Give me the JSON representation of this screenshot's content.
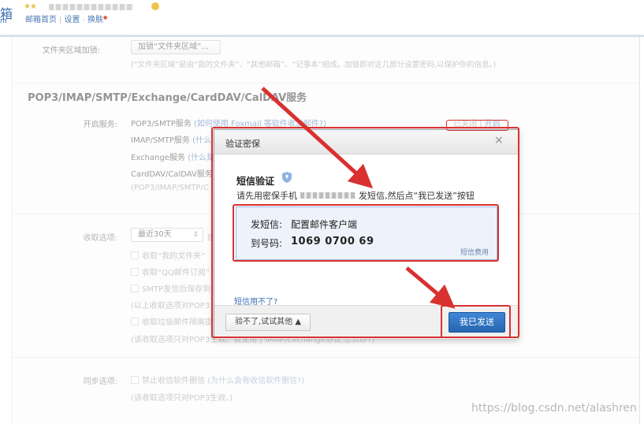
{
  "header": {
    "logo_char": "箱",
    "logo_sub": "m",
    "stars": "★★",
    "nav_home": "邮箱首页",
    "nav_settings": "设置",
    "nav_skin": "换肤",
    "nav_sep": "|",
    "nav_dash": "-",
    "nav_dot": "●"
  },
  "folder_lock": {
    "label": "文件夹区域加锁:",
    "button": "加锁“文件夹区域”...",
    "hint": "(“文件夹区域”是由“我的文件夹”、“其他邮箱”、“记事本”组成。加锁即对这几部分设置密码,以保护你的信息。)"
  },
  "pop_section": {
    "title": "POP3/IMAP/SMTP/Exchange/CardDAV/CalDAV服务",
    "enable_label": "开启服务:",
    "pop3_label": "POP3/SMTP服务",
    "pop3_help": "(如何使用 Foxmail 等软件收发邮件?)",
    "imap_label": "IMAP/SMTP服务",
    "imap_help": "(什么",
    "exchange_label": "Exchange服务",
    "exchange_help": "(什么是",
    "carddav_label": "CardDAV/CalDAV服务",
    "note": "(POP3/IMAP/SMTP/C",
    "status_closed": "已关闭",
    "status_sep": "|",
    "status_open": "开启"
  },
  "receive": {
    "label": "收取选项:",
    "select": "最近30天",
    "select_arrow": "⇕",
    "after_select": "的",
    "opt1": "收取“我的文件夹”",
    "opt2": "收取“QQ邮件订阅”",
    "opt3": "SMTP发信后保存到",
    "note1": "(以上收取选项对POP3",
    "opt4": "收取垃圾邮件隔离提",
    "note2": "(该收取选项只对POP3生效。我使用了IMAP/Exchange协议,怎么办?)"
  },
  "sync": {
    "label": "同步选项:",
    "opt": "禁止收信软件删信",
    "opt_help": "(为什么会有收信软件删信?)",
    "note": "(该收取选项只对POP3生效。)"
  },
  "dialog": {
    "title": "验证密保",
    "close": "×",
    "sms_heading": "短信验证",
    "instruction_prefix": "请先用密保手机",
    "instruction_suffix": "发短信,然后点“我已发送”按钮",
    "send_label": "发短信:",
    "send_content": "配置邮件客户端",
    "to_label": "到号码:",
    "to_number": "1069 0700 69",
    "sms_fee": "短信费用",
    "cant_use_link": "短信用不了?",
    "try_other": "验不了,试试其他 ▲",
    "confirm_sent": "我已发送"
  },
  "watermark": "https://blog.csdn.net/alashren",
  "colors": {
    "annotation_red": "#d9312f",
    "primary_button": "#2f74c4",
    "link": "#4a78b4"
  }
}
